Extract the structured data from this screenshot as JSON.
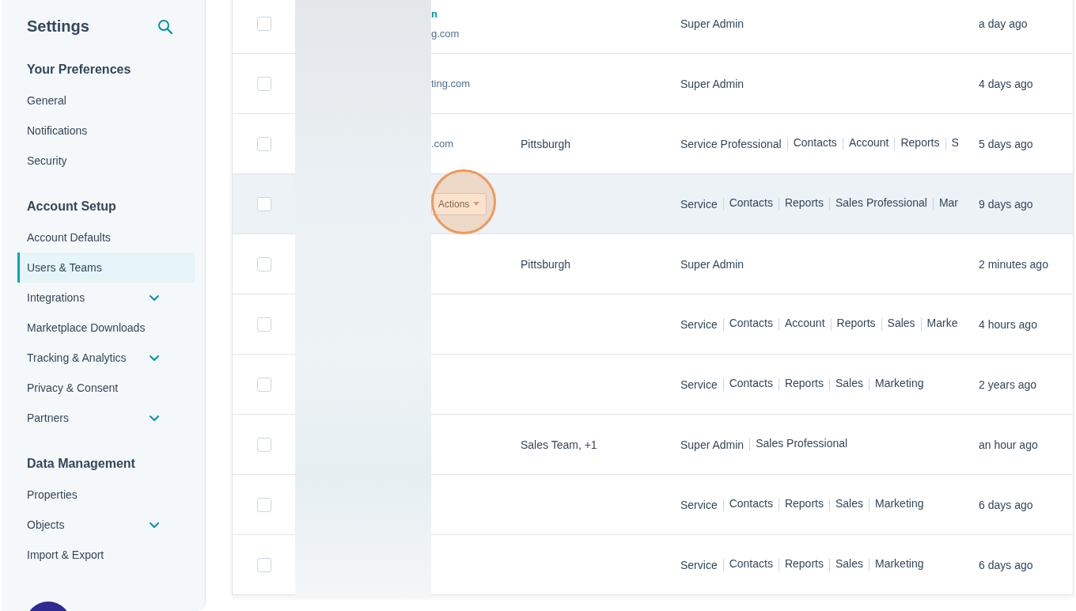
{
  "sidebar": {
    "title": "Settings",
    "sections": [
      {
        "heading": "Your Preferences",
        "items": [
          {
            "label": "General",
            "selected": false
          },
          {
            "label": "Notifications",
            "selected": false
          },
          {
            "label": "Security",
            "selected": false
          }
        ]
      },
      {
        "heading": "Account Setup",
        "items": [
          {
            "label": "Account Defaults",
            "selected": false
          },
          {
            "label": "Users & Teams",
            "selected": true
          },
          {
            "label": "Integrations",
            "selected": false,
            "expanded": false
          },
          {
            "label": "Marketplace Downloads",
            "selected": false
          },
          {
            "label": "Tracking & Analytics",
            "selected": false,
            "expanded": false
          },
          {
            "label": "Privacy & Consent",
            "selected": false
          },
          {
            "label": "Partners",
            "selected": false,
            "expanded": false
          }
        ]
      },
      {
        "heading": "Data Management",
        "items": [
          {
            "label": "Properties",
            "selected": false
          },
          {
            "label": "Objects",
            "selected": false,
            "expanded": false
          },
          {
            "label": "Import & Export",
            "selected": false
          }
        ]
      }
    ]
  },
  "users": [
    {
      "checked": false,
      "highlighted": false,
      "name": "n",
      "email": "g.com",
      "permissions": [
        "Super Admin"
      ],
      "last_active": "a day ago"
    },
    {
      "checked": false,
      "highlighted": false,
      "email": "ting.com",
      "permissions": [
        "Super Admin"
      ],
      "last_active": "4 days ago"
    },
    {
      "checked": false,
      "highlighted": false,
      "email": ".com",
      "team": "Pittsburgh",
      "permissions": [
        "Service Professional",
        "Contacts",
        "Account",
        "Reports",
        "S"
      ],
      "last_active": "5 days ago"
    },
    {
      "checked": false,
      "highlighted": true,
      "actions_button": "Actions",
      "permissions": [
        "Service",
        "Contacts",
        "Reports",
        "Sales Professional",
        "Mar"
      ],
      "last_active": "9 days ago"
    },
    {
      "checked": false,
      "highlighted": false,
      "team": "Pittsburgh",
      "permissions": [
        "Super Admin"
      ],
      "last_active": "2 minutes ago"
    },
    {
      "checked": false,
      "highlighted": false,
      "permissions": [
        "Service",
        "Contacts",
        "Account",
        "Reports",
        "Sales",
        "Marke"
      ],
      "last_active": "4 hours ago"
    },
    {
      "checked": false,
      "highlighted": false,
      "permissions": [
        "Service",
        "Contacts",
        "Reports",
        "Sales",
        "Marketing"
      ],
      "last_active": "2 years ago"
    },
    {
      "checked": false,
      "highlighted": false,
      "team": "Sales Team, +1",
      "permissions": [
        "Super Admin",
        "Sales Professional"
      ],
      "last_active": "an hour ago"
    },
    {
      "checked": false,
      "highlighted": false,
      "permissions": [
        "Service",
        "Contacts",
        "Reports",
        "Sales",
        "Marketing"
      ],
      "last_active": "6 days ago"
    },
    {
      "checked": false,
      "highlighted": false,
      "permissions": [
        "Service",
        "Contacts",
        "Reports",
        "Sales",
        "Marketing"
      ],
      "last_active": "6 days ago"
    }
  ]
}
